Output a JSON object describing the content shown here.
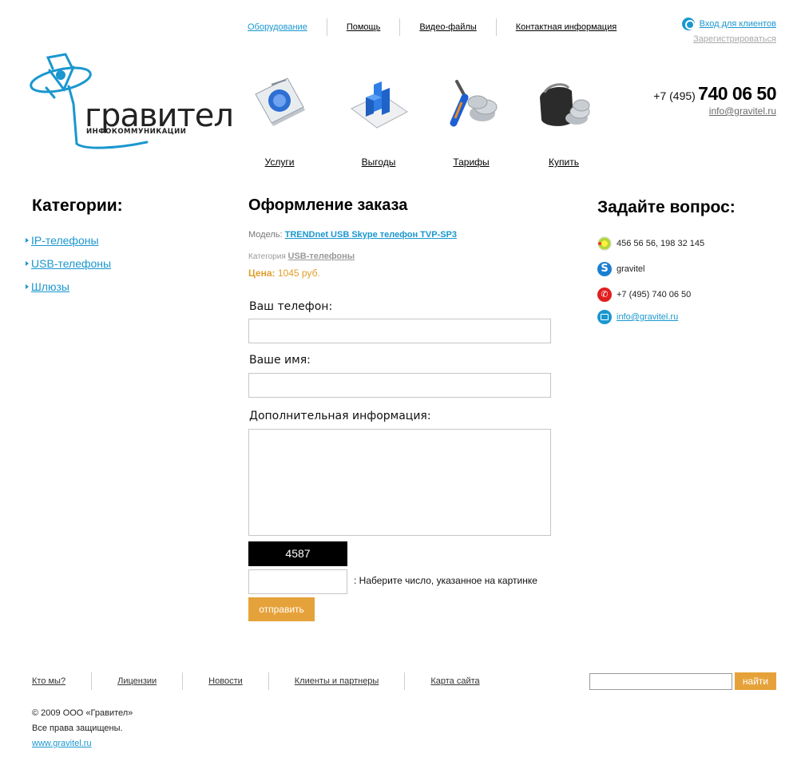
{
  "top_nav": {
    "items": [
      "Оборудование",
      "Помощь",
      "Видео-файлы",
      "Контактная информация"
    ]
  },
  "auth": {
    "login_label": "Вход для клиентов",
    "register_label": "Зарегистрироваться"
  },
  "logo": {
    "name": "гравител",
    "subtitle": "ИНФОКОММУНИКАЦИИ"
  },
  "header_contacts": {
    "phone_code": "+7 (495)",
    "phone_number": "740 06 50",
    "email": "info@gravitel.ru"
  },
  "icon_menu": [
    {
      "label": "Услуги",
      "icon": "book-icon"
    },
    {
      "label": "Выгоды",
      "icon": "chart-icon"
    },
    {
      "label": "Тарифы",
      "icon": "screwdriver-coins-icon"
    },
    {
      "label": "Купить",
      "icon": "wallet-coins-icon"
    }
  ],
  "categories": {
    "title": "Категории:",
    "items": [
      "IP-телефоны",
      "USB-телефоны",
      "Шлюзы"
    ]
  },
  "order": {
    "title": "Оформление заказа",
    "model_label": "Модель:",
    "model_value": "TRENDnet USB Skype телефон TVP-SP3",
    "category_label": "Категория",
    "category_value": "USB-телефоны",
    "price_label": "Цена:",
    "price_value": "1045 руб.",
    "phone_label": "Ваш телефон:",
    "phone_value": "",
    "name_label": "Ваше имя:",
    "name_value": "",
    "info_label": "Дополнительная информация:",
    "info_value": "",
    "captcha_text": "4587",
    "captcha_value": "",
    "captcha_hint": ": Наберите число, указанное на картинке",
    "submit_label": "отправить"
  },
  "ask": {
    "title": "Задайте вопрос:",
    "icq": "456 56 56, 198 32 145",
    "skype": "gravitel",
    "phone": "+7 (495) 740 06 50",
    "email": "info@gravitel.ru"
  },
  "footer": {
    "nav": [
      "Кто мы?",
      "Лицензии",
      "Новости",
      "Клиенты и партнеры",
      "Карта сайта"
    ],
    "search_value": "",
    "search_button": "найти",
    "copyright": "© 2009 ООО «Гравител»",
    "rights": "Все права защищены.",
    "site": "www.gravitel.ru"
  },
  "colors": {
    "link": "#1a97cf",
    "accent": "#e6a23a",
    "price": "#e19c2b"
  }
}
